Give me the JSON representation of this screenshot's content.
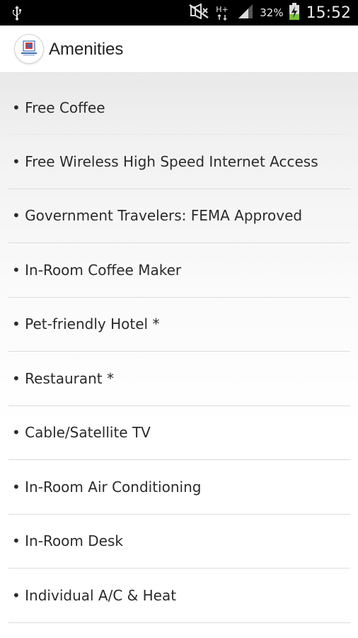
{
  "status_bar": {
    "battery_percent": "32%",
    "time": "15:52",
    "network_type": "H+",
    "icons": [
      "usb-icon",
      "mute-icon",
      "network-type-icon",
      "signal-icon",
      "battery-charging-icon"
    ]
  },
  "app_bar": {
    "title": "Amenities",
    "logo_icon": "hotel-logo-icon"
  },
  "amenities": {
    "items": [
      {
        "label": "• Free Coffee"
      },
      {
        "label": "• Free Wireless High Speed Internet Access"
      },
      {
        "label": "• Government Travelers: FEMA Approved"
      },
      {
        "label": "• In-Room Coffee Maker"
      },
      {
        "label": "• Pet-friendly Hotel *"
      },
      {
        "label": "• Restaurant *"
      },
      {
        "label": "• Cable/Satellite TV"
      },
      {
        "label": "• In-Room Air Conditioning"
      },
      {
        "label": "• In-Room Desk"
      },
      {
        "label": "• Individual A/C & Heat"
      }
    ]
  },
  "colors": {
    "status_bar_bg": "#000000",
    "app_bar_bg": "#ffffff",
    "text": "#2b2b2b",
    "divider": "#dcdcdc",
    "charging_green": "#7cc43b"
  }
}
